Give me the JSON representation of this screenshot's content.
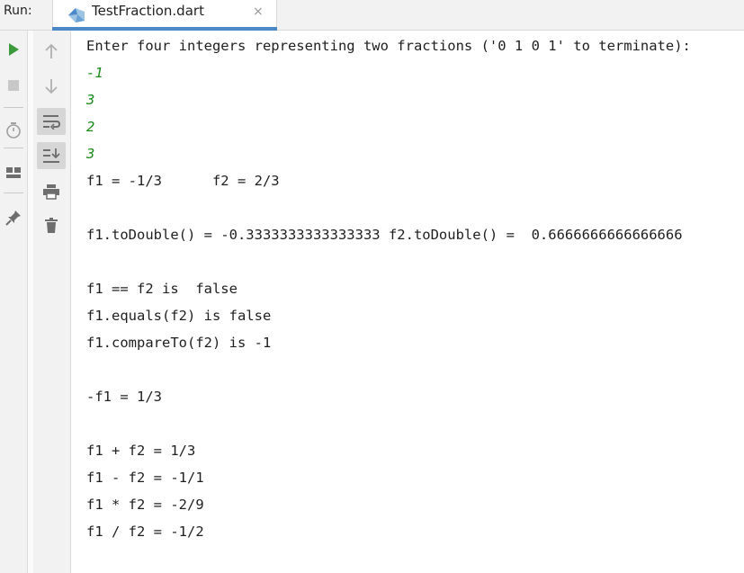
{
  "header": {
    "run_label": "Run:",
    "tab_title": "TestFraction.dart",
    "tab_close": "×"
  },
  "console": {
    "lines": [
      {
        "text": "Enter four integers representing two fractions ('0 1 0 1' to terminate):",
        "type": "output"
      },
      {
        "text": "-1",
        "type": "input"
      },
      {
        "text": "3",
        "type": "input"
      },
      {
        "text": "2",
        "type": "input"
      },
      {
        "text": "3",
        "type": "input"
      },
      {
        "text": "f1 = -1/3      f2 = 2/3",
        "type": "output"
      },
      {
        "text": "",
        "type": "output"
      },
      {
        "text": "f1.toDouble() = -0.3333333333333333 f2.toDouble() =  0.6666666666666666",
        "type": "output"
      },
      {
        "text": "",
        "type": "output"
      },
      {
        "text": "f1 == f2 is  false",
        "type": "output"
      },
      {
        "text": "f1.equals(f2) is false",
        "type": "output"
      },
      {
        "text": "f1.compareTo(f2) is -1",
        "type": "output"
      },
      {
        "text": "",
        "type": "output"
      },
      {
        "text": "-f1 = 1/3",
        "type": "output"
      },
      {
        "text": "",
        "type": "output"
      },
      {
        "text": "f1 + f2 = 1/3",
        "type": "output"
      },
      {
        "text": "f1 - f2 = -1/1",
        "type": "output"
      },
      {
        "text": "f1 * f2 = -2/9",
        "type": "output"
      },
      {
        "text": "f1 / f2 = -1/2",
        "type": "output"
      }
    ]
  },
  "toolbar_left": [
    {
      "icon": "run-icon",
      "color": "#3c9a3c"
    },
    {
      "icon": "stop-icon",
      "color": "#c8c8c8"
    },
    {
      "icon": "stopwatch-icon",
      "color": "#a0a0a0"
    },
    {
      "icon": "layout-icon",
      "color": "#6e6e6e"
    },
    {
      "icon": "pin-icon",
      "color": "#6e6e6e"
    }
  ],
  "toolbar_right": [
    {
      "icon": "arrow-up-icon",
      "color": "#b0b0b0"
    },
    {
      "icon": "arrow-down-icon",
      "color": "#b0b0b0"
    },
    {
      "icon": "soft-wrap-icon",
      "color": "#6e6e6e",
      "active": true
    },
    {
      "icon": "scroll-to-end-icon",
      "color": "#6e6e6e",
      "active": true
    },
    {
      "icon": "print-icon",
      "color": "#6e6e6e"
    },
    {
      "icon": "trash-icon",
      "color": "#6e6e6e"
    }
  ],
  "colors": {
    "input_text": "#1a8a1a",
    "output_text": "#1f1f1f",
    "tab_underline": "#4a88c7"
  }
}
